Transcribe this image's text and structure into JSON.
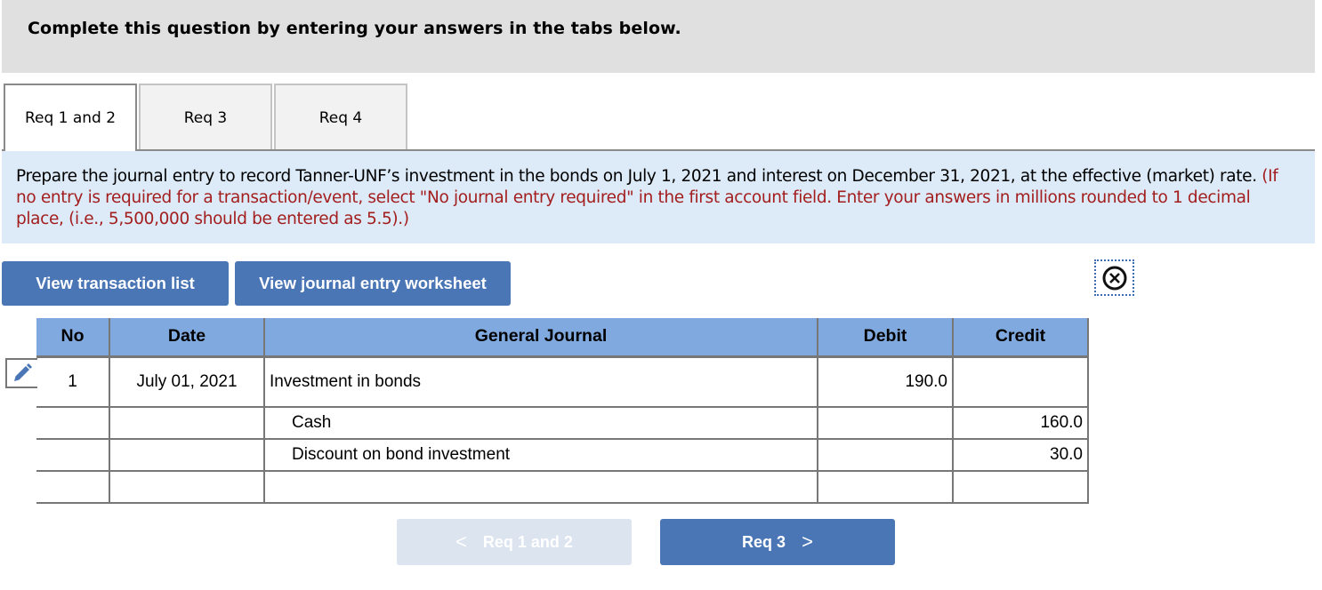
{
  "header": {
    "instruction": "Complete this question by entering your answers in the tabs below."
  },
  "tabs": [
    {
      "label": "Req 1 and 2",
      "active": true
    },
    {
      "label": "Req 3",
      "active": false
    },
    {
      "label": "Req 4",
      "active": false
    }
  ],
  "prompt": {
    "main_text": "Prepare the journal entry to record Tanner-UNF’s investment in the bonds on July 1, 2021 and interest on December 31, 2021, at the effective (market) rate.",
    "note_text": "(If no entry is required for a transaction/event, select \"No journal entry required\" in the first account field. Enter your answers in millions rounded to 1 decimal place, (i.e., 5,500,000 should be entered as 5.5).)",
    "note_color": "#a31e1e"
  },
  "toolbar": {
    "view_transaction_list": "View transaction list",
    "view_journal_worksheet": "View journal entry worksheet",
    "close_icon": "circle-x-icon"
  },
  "journal": {
    "columns": [
      "No",
      "Date",
      "General Journal",
      "Debit",
      "Credit"
    ],
    "rows": [
      {
        "no": "1",
        "date": "July 01, 2021",
        "account": "Investment in bonds",
        "debit": "190.0",
        "credit": "",
        "indent": false
      },
      {
        "no": "",
        "date": "",
        "account": "Cash",
        "debit": "",
        "credit": "160.0",
        "indent": true
      },
      {
        "no": "",
        "date": "",
        "account": "Discount on bond investment",
        "debit": "",
        "credit": "30.0",
        "indent": true
      },
      {
        "no": "",
        "date": "",
        "account": "",
        "debit": "",
        "credit": "",
        "indent": false
      }
    ],
    "edit_icon": "pencil-icon"
  },
  "navigation": {
    "prev_label": "Req 1 and 2",
    "next_label": "Req 3",
    "prev_icon": "<",
    "next_icon": ">"
  },
  "colors": {
    "accent_blue": "#4a76b5",
    "table_header": "#80aadf",
    "prompt_bg": "#ddeaf7",
    "disabled_button": "#dbe4ef"
  }
}
